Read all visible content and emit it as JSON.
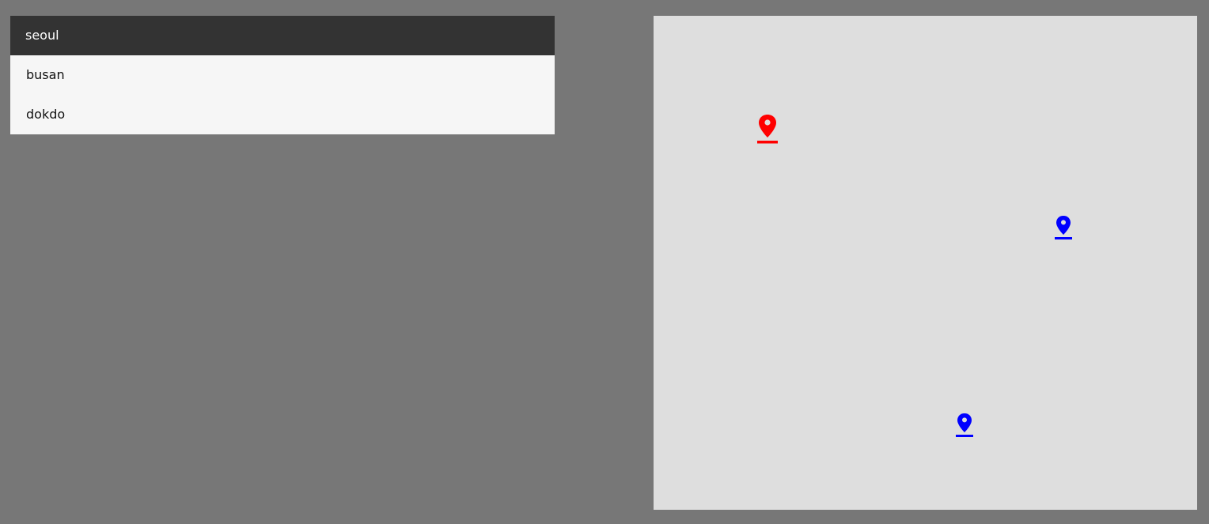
{
  "cities": [
    {
      "id": "seoul",
      "label": "seoul",
      "selected": true
    },
    {
      "id": "busan",
      "label": "busan",
      "selected": false
    },
    {
      "id": "dokdo",
      "label": "dokdo",
      "selected": false
    }
  ],
  "map": {
    "markers": [
      {
        "city": "seoul",
        "icon": "map-pin-icon",
        "color": "#ff0000",
        "state": "selected"
      },
      {
        "city": "busan",
        "icon": "map-pin-icon",
        "color": "#0000ff",
        "state": "default"
      },
      {
        "city": "dokdo",
        "icon": "map-pin-icon",
        "color": "#0000ff",
        "state": "default"
      }
    ]
  },
  "colors": {
    "background": "#777777",
    "list_background": "#f6f6f6",
    "selected_background": "#333333",
    "map_background": "#dedede",
    "selected_marker": "#ff0000",
    "default_marker": "#0000ff"
  }
}
